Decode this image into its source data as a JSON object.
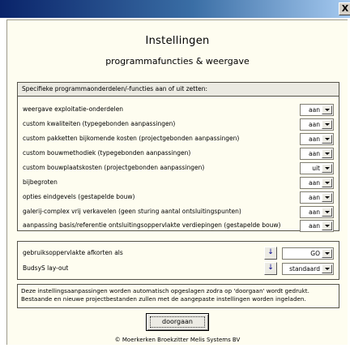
{
  "window": {
    "close_glyph": "X"
  },
  "title": "Instellingen",
  "subtitle": "programmafuncties & weergave",
  "functions": {
    "header": "Specifieke programmaonderdelen/-functies aan of uit zetten:",
    "rows": [
      {
        "label": "weergave exploitatie-onderdelen",
        "value": "aan"
      },
      {
        "label": "custom kwaliteiten (typegebonden aanpassingen)",
        "value": "aan"
      },
      {
        "label": "custom pakketten bijkomende kosten (projectgebonden aanpassingen)",
        "value": "aan"
      },
      {
        "label": "custom bouwmethodiek (typegebonden aanpassingen)",
        "value": "aan"
      },
      {
        "label": "custom bouwplaatskosten (projectgebonden aanpassingen)",
        "value": "uit"
      },
      {
        "label": "bijbegroten",
        "value": "aan"
      },
      {
        "label": "opties eindgevels (gestapelde bouw)",
        "value": "aan"
      },
      {
        "label": "galerij-complex vrij verkavelen (geen sturing aantal ontsluitingspunten)",
        "value": "aan"
      },
      {
        "label": "aanpassing basis/referentie ontsluitingsoppervlakte verdiepingen (gestapelde bouw)",
        "value": "aan"
      }
    ]
  },
  "display": {
    "rows": [
      {
        "label": "gebruiksoppervlakte afkorten als",
        "value": "GO",
        "sort_icon": "sort-az-icon"
      },
      {
        "label": "BudsyS lay-out",
        "value": "standaard",
        "sort_icon": "sort-az-icon"
      }
    ]
  },
  "info": {
    "line1": "Deze instellingsaanpassingen worden automatisch opgeslagen zodra op 'doorgaan' wordt gedrukt.",
    "line2": "Bestaande en nieuwe projectbestanden zullen met de aangepaste instellingen worden ingeladen."
  },
  "ok_button": "doorgaan",
  "copyright": "© Moerkerken Broekzitter Melis Systems BV"
}
